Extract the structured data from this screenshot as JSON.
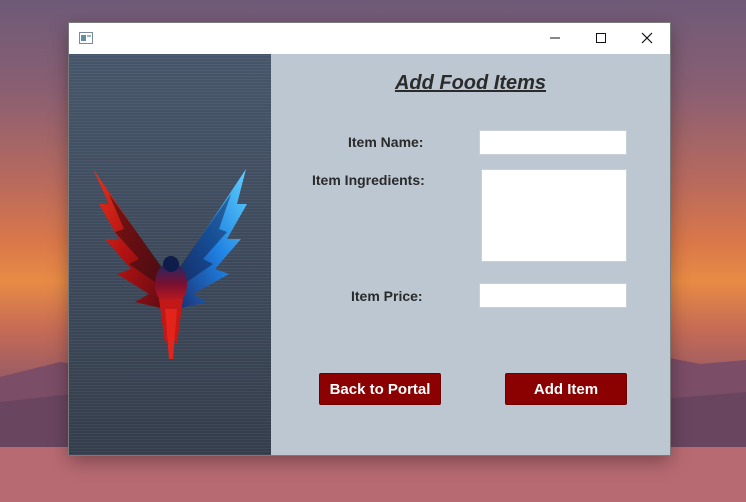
{
  "form": {
    "title": "Add Food Items",
    "item_name_label": "Item Name:",
    "item_name_value": "",
    "item_ingredients_label": "Item Ingredients:",
    "item_ingredients_value": "",
    "item_price_label": "Item Price:",
    "item_price_value": ""
  },
  "buttons": {
    "back_label": "Back to Portal",
    "add_label": "Add Item"
  },
  "icons": {
    "app": "app-window-icon",
    "minimize": "minimize-icon",
    "maximize": "maximize-icon",
    "close": "close-icon",
    "image": "phoenix-logo-image"
  },
  "colors": {
    "button_bg": "#8b0000",
    "form_bg": "#bcc7d2",
    "title_text": "#2b2b2b"
  }
}
